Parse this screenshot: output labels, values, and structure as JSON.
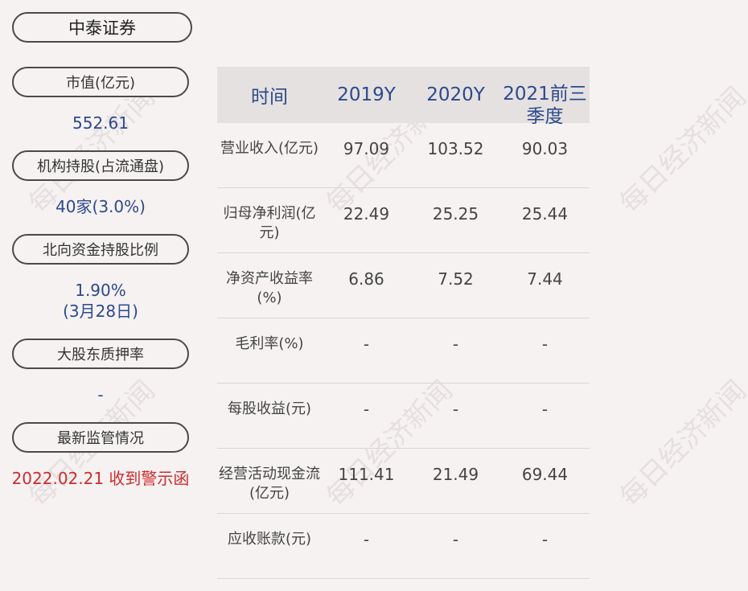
{
  "company": "中泰证券",
  "sidebar": {
    "items": [
      {
        "label": "市值(亿元)",
        "value": "552.61"
      },
      {
        "label": "机构持股(占流通盘)",
        "value": "40家(3.0%)"
      },
      {
        "label": "北向资金持股比例",
        "value": "1.90%",
        "value2": "(3月28日)"
      },
      {
        "label": "大股东质押率",
        "value": "-"
      },
      {
        "label": "最新监管情况",
        "value": "2022.02.21 收到警示函"
      }
    ]
  },
  "table": {
    "headers": [
      "时间",
      "2019Y",
      "2020Y",
      "2021前三季度"
    ],
    "rows": [
      {
        "label": "营业收入(亿元)",
        "values": [
          "97.09",
          "103.52",
          "90.03"
        ]
      },
      {
        "label": "归母净利润(亿元)",
        "values": [
          "22.49",
          "25.25",
          "25.44"
        ]
      },
      {
        "label": "净资产收益率(%)",
        "values": [
          "6.86",
          "7.52",
          "7.44"
        ]
      },
      {
        "label": "毛利率(%)",
        "values": [
          "-",
          "-",
          "-"
        ]
      },
      {
        "label": "每股收益(元)",
        "values": [
          "-",
          "-",
          "-"
        ]
      },
      {
        "label": "经营活动现金流(亿元)",
        "values": [
          "111.41",
          "21.49",
          "69.44"
        ]
      },
      {
        "label": "应收账款(元)",
        "values": [
          "-",
          "-",
          "-"
        ]
      }
    ]
  },
  "watermark": "每日经济新闻",
  "colors": {
    "value_blue": "#2c4a8c",
    "alert_red": "#d22b2b",
    "header_bg": "#e5e1e1",
    "page_bg": "#f6f2f2"
  }
}
